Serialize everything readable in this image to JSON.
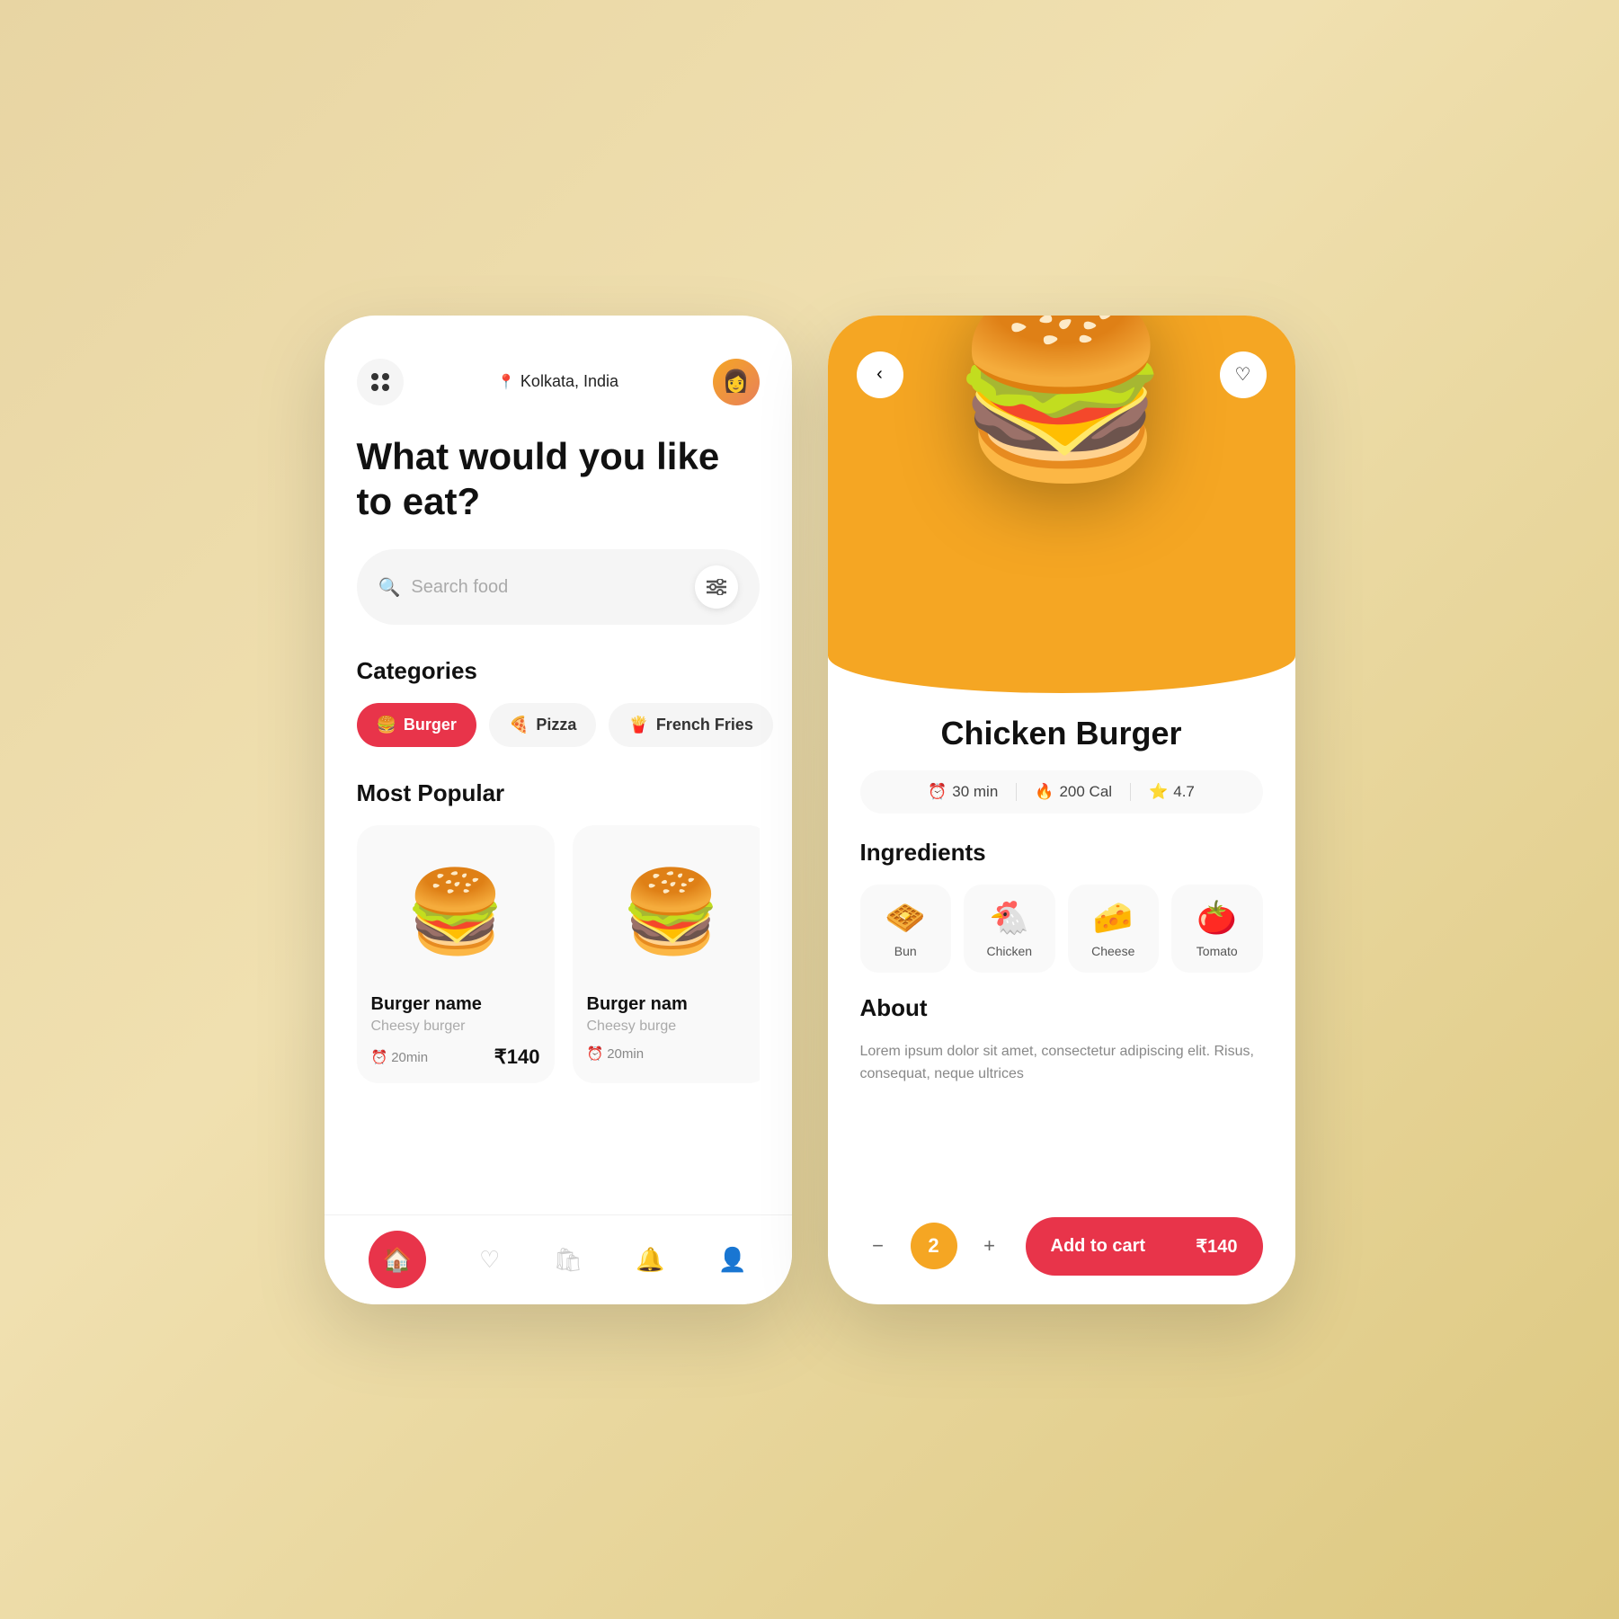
{
  "app": {
    "background_color": "#e8d5a3"
  },
  "left_phone": {
    "header": {
      "location": "Kolkata, India",
      "avatar_emoji": "👩"
    },
    "hero_text": "What would you like to eat?",
    "search": {
      "placeholder": "Search food",
      "filter_icon": "⚙"
    },
    "categories_title": "Categories",
    "categories": [
      {
        "id": "burger",
        "label": "Burger",
        "emoji": "🍔",
        "active": true
      },
      {
        "id": "pizza",
        "label": "Pizza",
        "emoji": "🍕",
        "active": false
      },
      {
        "id": "fries",
        "label": "French Fries",
        "emoji": "🍟",
        "active": false
      }
    ],
    "popular_title": "Most Popular",
    "popular_items": [
      {
        "name": "Burger name",
        "sub": "Cheesy burger",
        "time": "20min",
        "price": "₹140",
        "emoji": "🍔"
      },
      {
        "name": "Burger nam",
        "sub": "Cheesy burge",
        "time": "20min",
        "price": "",
        "emoji": "🍔"
      }
    ],
    "bottom_nav": [
      {
        "id": "home",
        "label": "Home",
        "icon": "🏠",
        "active": true
      },
      {
        "id": "heart",
        "label": "Favorites",
        "icon": "♡",
        "active": false
      },
      {
        "id": "bag",
        "label": "Cart",
        "icon": "🛍",
        "active": false
      },
      {
        "id": "bell",
        "label": "Notifications",
        "icon": "🔔",
        "active": false
      },
      {
        "id": "user",
        "label": "Profile",
        "icon": "👤",
        "active": false
      }
    ]
  },
  "right_phone": {
    "back_label": "‹",
    "fav_icon": "♡",
    "item_name": "Chicken Burger",
    "meta": {
      "time": "30 min",
      "calories": "200 Cal",
      "rating": "4.7"
    },
    "ingredients_title": "Ingredients",
    "ingredients": [
      {
        "name": "Bun",
        "emoji": "🧇"
      },
      {
        "name": "Chicken",
        "emoji": "🐔"
      },
      {
        "name": "Cheese",
        "emoji": "🧀"
      },
      {
        "name": "Tomato",
        "emoji": "🍅"
      }
    ],
    "about_title": "About",
    "about_text": "Lorem ipsum dolor sit amet, consectetur adipiscing elit. Risus, consequat, neque ultrices",
    "quantity": "2",
    "add_to_cart_label": "Add to cart",
    "price": "₹140",
    "food_emoji": "🍔"
  }
}
